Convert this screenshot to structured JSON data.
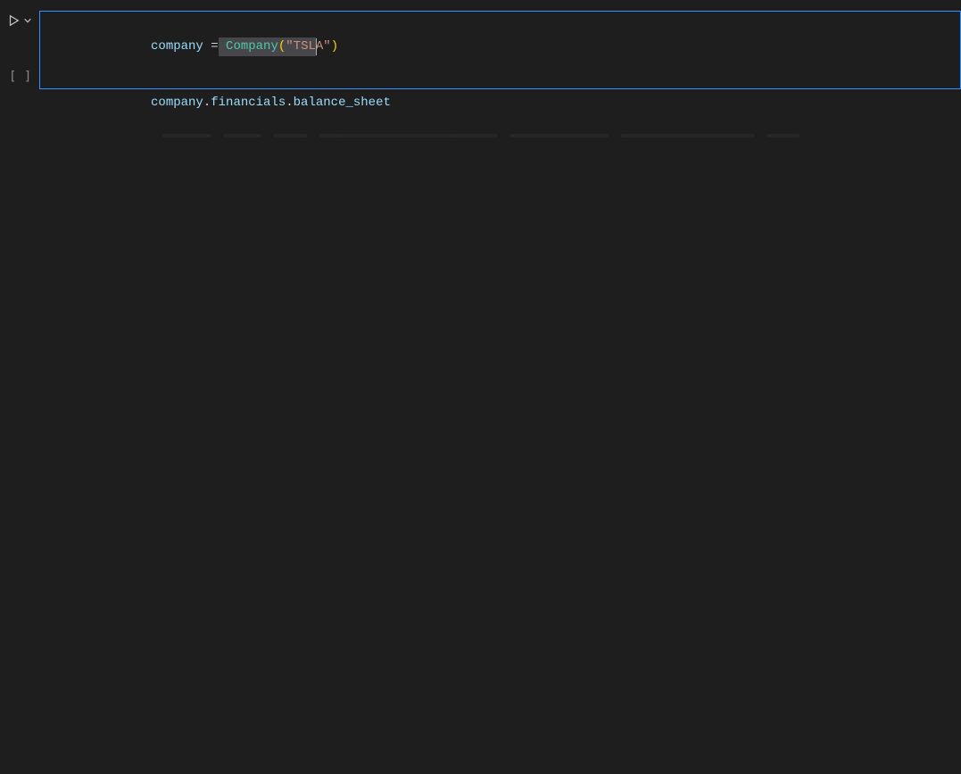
{
  "cell": {
    "exec_indicator": "[ ]",
    "code": {
      "line1": {
        "var": "company",
        "sp1": " ",
        "eq": "=",
        "sp2": " ",
        "cls": "Company",
        "lp": "(",
        "str": "\"TSLA\"",
        "rp": ")"
      },
      "line2": {
        "obj": "company",
        "dot1": ".",
        "prop1": "financials",
        "dot2": ".",
        "prop2": "balance_sheet"
      }
    }
  }
}
